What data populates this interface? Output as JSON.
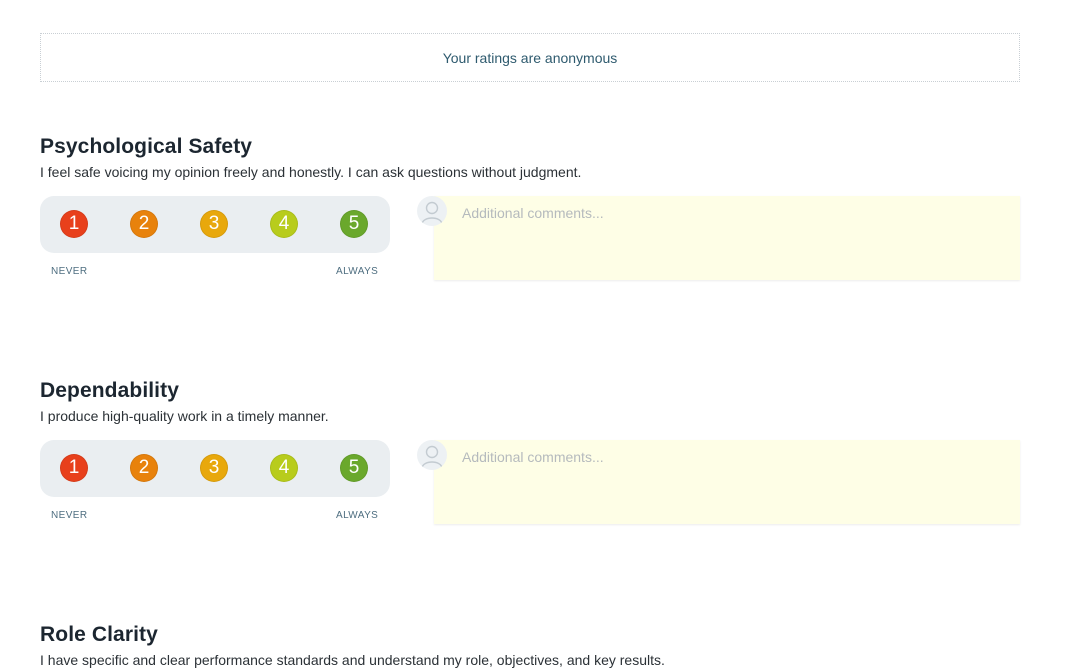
{
  "notice": {
    "text": "Your ratings are anonymous"
  },
  "sections": [
    {
      "title": "Psychological Safety",
      "description": "I feel safe voicing my opinion freely and honestly. I can ask questions without judgment.",
      "ratings": [
        "1",
        "2",
        "3",
        "4",
        "5"
      ],
      "scale_low": "NEVER",
      "scale_high": "ALWAYS",
      "comment_placeholder": "Additional comments..."
    },
    {
      "title": "Dependability",
      "description": "I produce high-quality work in a timely manner.",
      "ratings": [
        "1",
        "2",
        "3",
        "4",
        "5"
      ],
      "scale_low": "NEVER",
      "scale_high": "ALWAYS",
      "comment_placeholder": "Additional comments..."
    },
    {
      "title": "Role Clarity",
      "description": "I have specific and clear performance standards and understand my role, objectives, and key results."
    }
  ],
  "rating_colors": [
    "#e8401c",
    "#e8820c",
    "#e8a80c",
    "#b8cc1c",
    "#6aa82c"
  ],
  "icons": {
    "avatar": "user-avatar-icon"
  }
}
